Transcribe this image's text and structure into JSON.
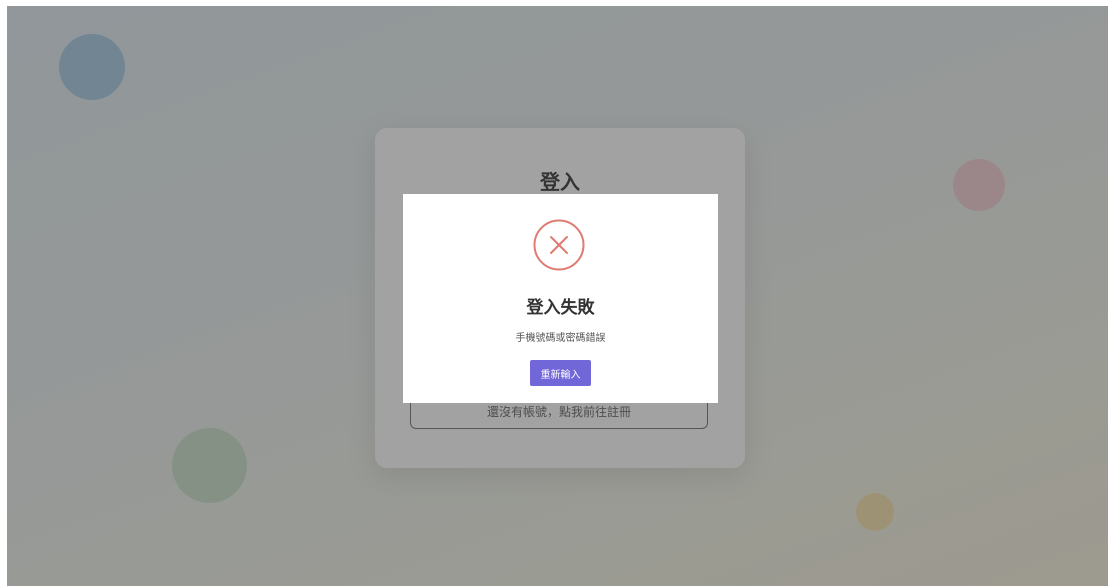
{
  "login": {
    "title": "登入",
    "register_link": "還沒有帳號，點我前往註冊"
  },
  "modal": {
    "icon": "x-circle-icon",
    "title": "登入失敗",
    "message": "手機號碼或密碼錯誤",
    "retry_label": "重新輸入"
  },
  "colors": {
    "accent": "#7267d8",
    "error": "#e07a73"
  }
}
